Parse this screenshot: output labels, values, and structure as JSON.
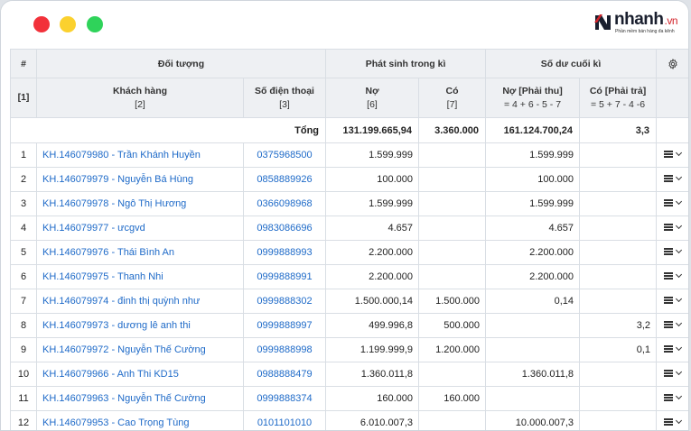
{
  "brand": {
    "name_main": "nhanh",
    "name_suffix": ".vn",
    "tagline": "Phần mềm bán hàng đa kênh",
    "accent_color": "#d2232a"
  },
  "window_controls": {
    "close_color": "#f2313a",
    "minimize_color": "#fbd12e",
    "maximize_color": "#2fd35a"
  },
  "table": {
    "group_headers": {
      "index": "#",
      "object": "Đối tượng",
      "period": "Phát sinh trong kì",
      "closing": "Số dư cuối kì"
    },
    "columns": {
      "index_code": "[1]",
      "customer": "Khách hàng",
      "customer_code": "[2]",
      "phone": "Số điện thoại",
      "phone_code": "[3]",
      "debit": "Nợ",
      "debit_code": "[6]",
      "credit": "Có",
      "credit_code": "[7]",
      "receivable": "Nợ [Phải thu]",
      "receivable_formula": "= 4 + 6 - 5 - 7",
      "payable": "Có [Phải trả]",
      "payable_formula": "= 5 + 7 - 4 -6"
    },
    "total": {
      "label": "Tổng",
      "debit": "131.199.665,94",
      "credit": "3.360.000",
      "receivable": "161.124.700,24",
      "payable": "3,3"
    },
    "rows": [
      {
        "idx": "1",
        "customer": "KH.146079980 - Trần Khánh Huyền",
        "phone": "0375968500",
        "debit": "1.599.999",
        "credit": "",
        "receivable": "1.599.999",
        "payable": ""
      },
      {
        "idx": "2",
        "customer": "KH.146079979 - Nguyễn Bá Hùng",
        "phone": "0858889926",
        "debit": "100.000",
        "credit": "",
        "receivable": "100.000",
        "payable": ""
      },
      {
        "idx": "3",
        "customer": "KH.146079978 - Ngô Thị Hương",
        "phone": "0366098968",
        "debit": "1.599.999",
        "credit": "",
        "receivable": "1.599.999",
        "payable": ""
      },
      {
        "idx": "4",
        "customer": "KH.146079977 - ưcgvd",
        "phone": "0983086696",
        "debit": "4.657",
        "credit": "",
        "receivable": "4.657",
        "payable": ""
      },
      {
        "idx": "5",
        "customer": "KH.146079976 - Thái Bình An",
        "phone": "0999888993",
        "debit": "2.200.000",
        "credit": "",
        "receivable": "2.200.000",
        "payable": ""
      },
      {
        "idx": "6",
        "customer": "KH.146079975 - Thanh Nhi",
        "phone": "0999888991",
        "debit": "2.200.000",
        "credit": "",
        "receivable": "2.200.000",
        "payable": ""
      },
      {
        "idx": "7",
        "customer": "KH.146079974 - đinh thị quỳnh như",
        "phone": "0999888302",
        "debit": "1.500.000,14",
        "credit": "1.500.000",
        "receivable": "0,14",
        "payable": ""
      },
      {
        "idx": "8",
        "customer": "KH.146079973 - dương lê anh thi",
        "phone": "0999888997",
        "debit": "499.996,8",
        "credit": "500.000",
        "receivable": "",
        "payable": "3,2"
      },
      {
        "idx": "9",
        "customer": "KH.146079972 - Nguyễn Thế Cường",
        "phone": "0999888998",
        "debit": "1.199.999,9",
        "credit": "1.200.000",
        "receivable": "",
        "payable": "0,1"
      },
      {
        "idx": "10",
        "customer": "KH.146079966 - Anh Thi KD15",
        "phone": "0988888479",
        "debit": "1.360.011,8",
        "credit": "",
        "receivable": "1.360.011,8",
        "payable": ""
      },
      {
        "idx": "11",
        "customer": "KH.146079963 - Nguyễn Thế Cường",
        "phone": "0999888374",
        "debit": "160.000",
        "credit": "160.000",
        "receivable": "",
        "payable": ""
      },
      {
        "idx": "12",
        "customer": "KH.146079953 - Cao Trọng Tùng",
        "phone": "0101101010",
        "debit": "6.010.007,3",
        "credit": "",
        "receivable": "10.000.007,3",
        "payable": ""
      }
    ],
    "row_action_icons": [
      "menu-icon",
      "chevron-down-icon"
    ],
    "settings_icon": "gear-icon"
  }
}
